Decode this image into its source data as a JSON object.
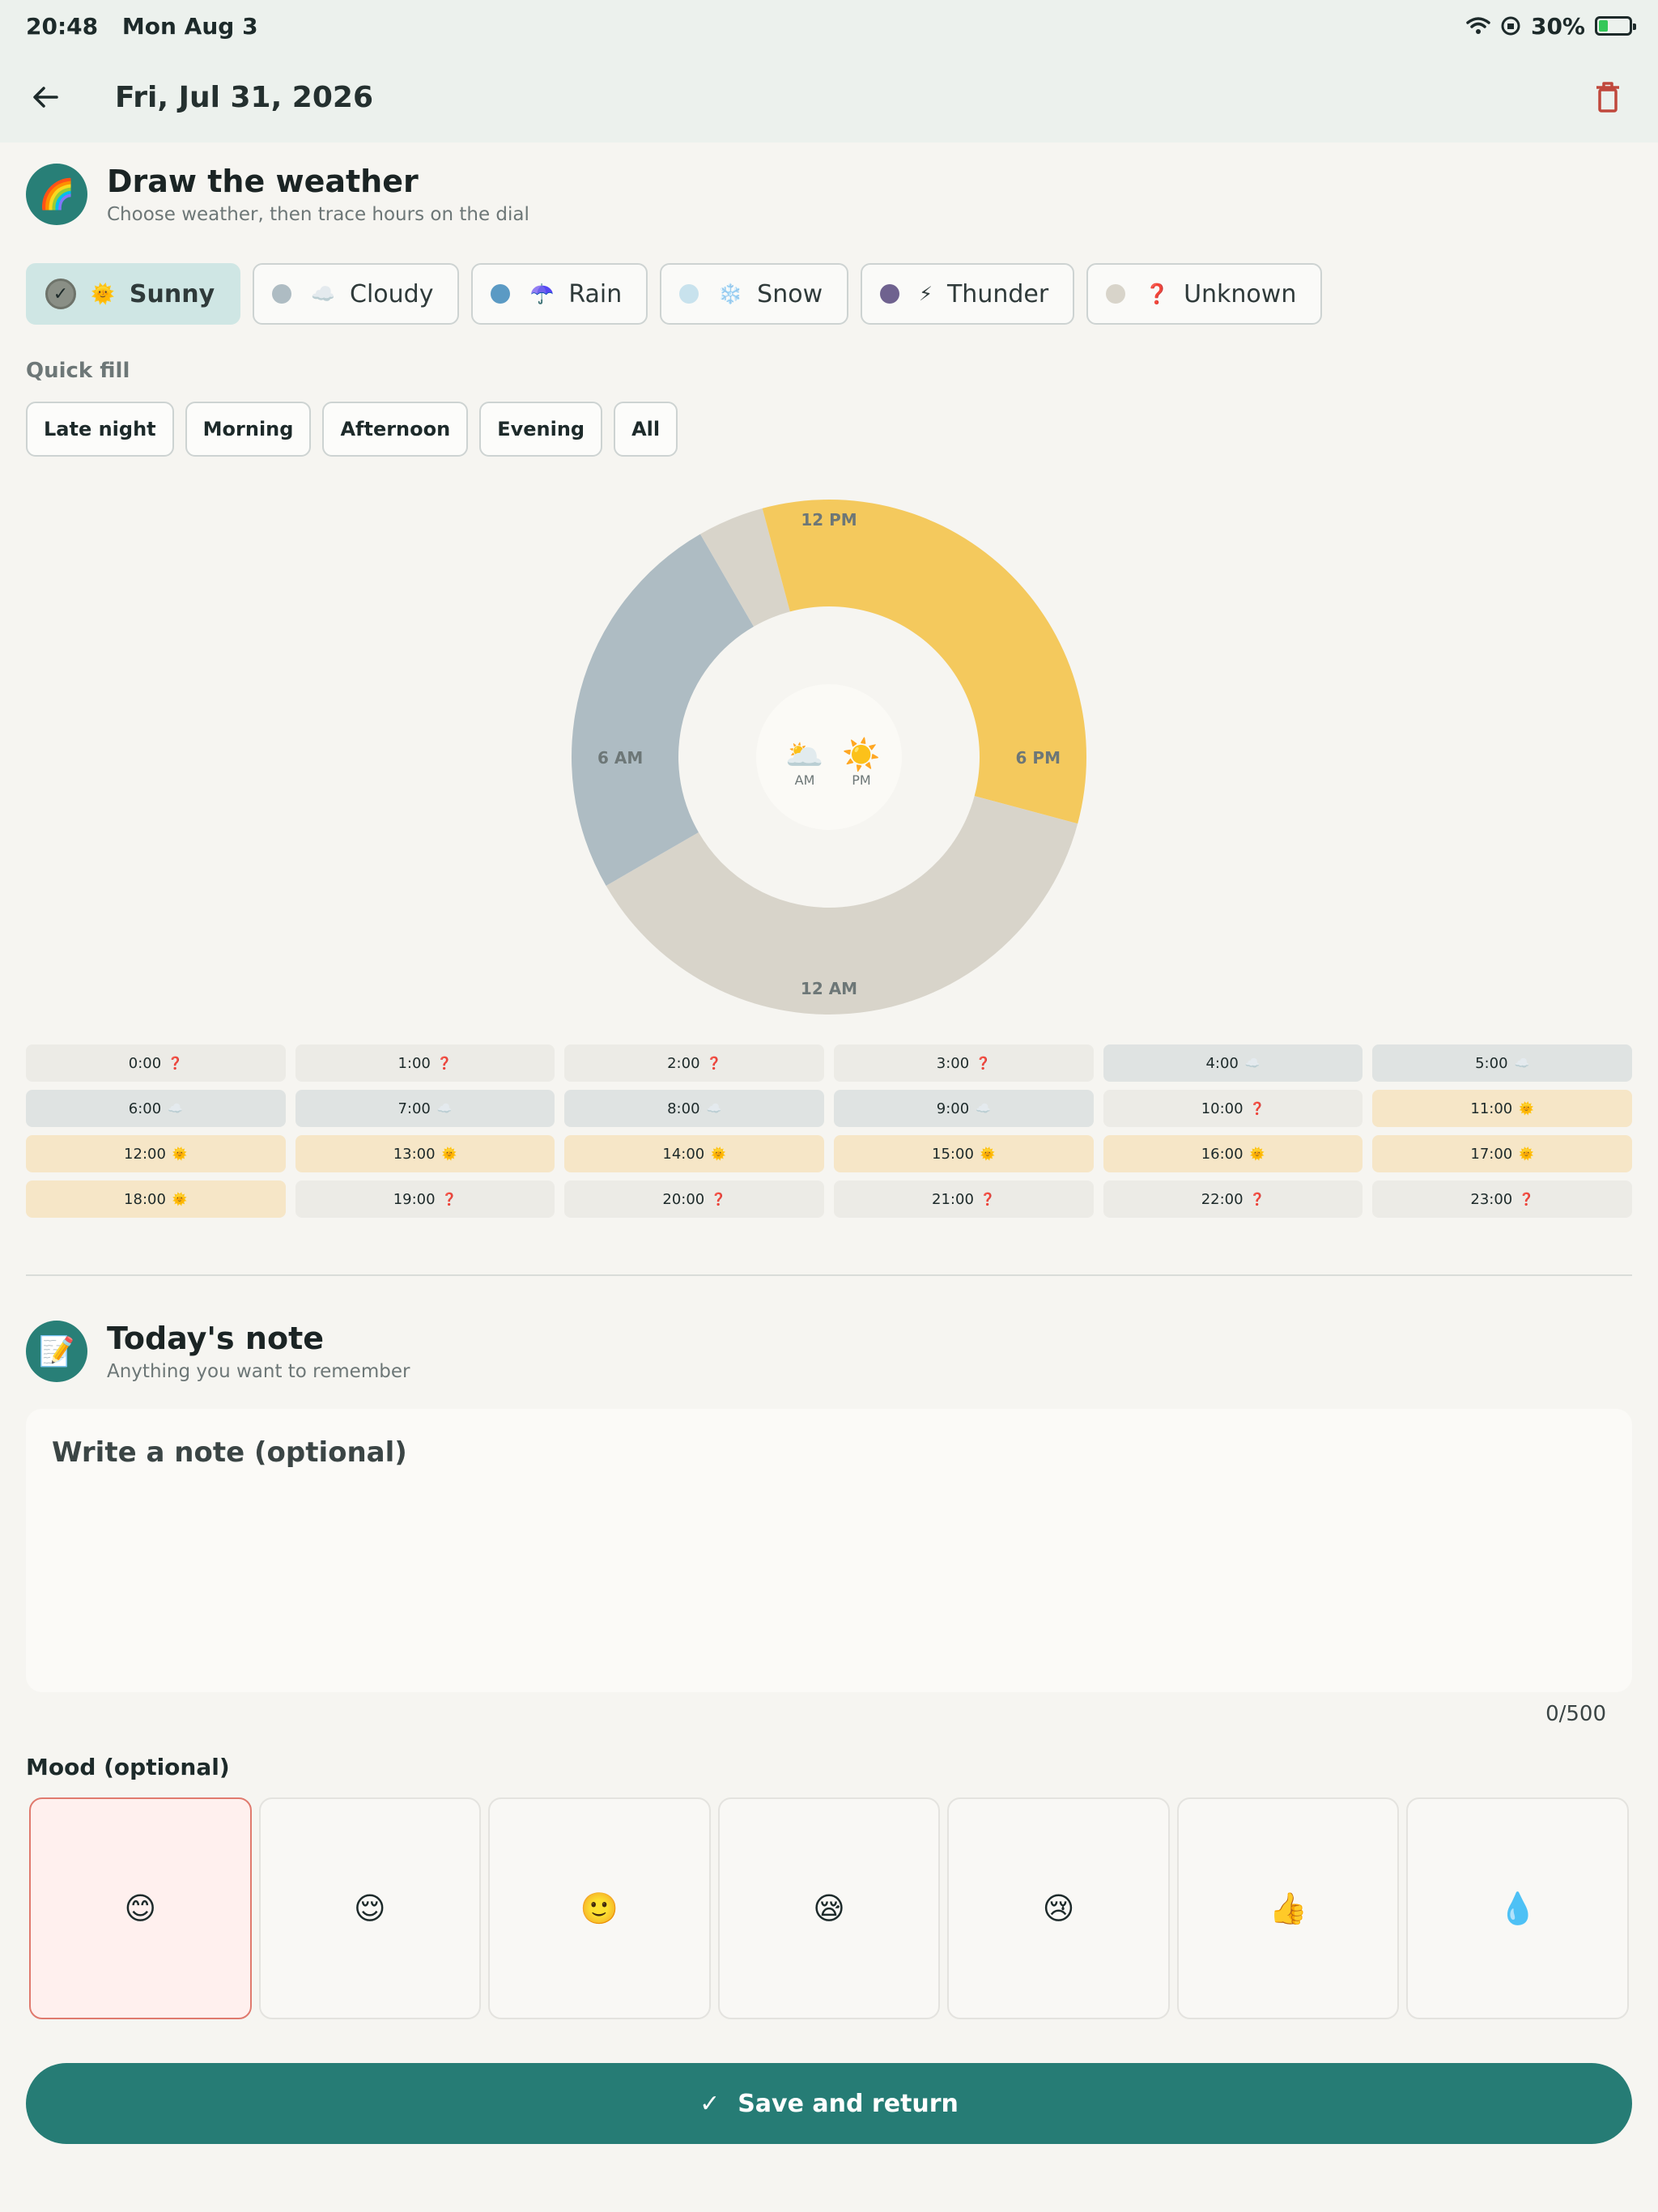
{
  "status": {
    "time": "20:48",
    "date": "Mon Aug 3",
    "battery": "30%",
    "battery_level": 0.3
  },
  "header": {
    "title": "Fri, Jul 31, 2026"
  },
  "weather_section": {
    "icon": "🌈",
    "title": "Draw the weather",
    "subtitle": "Choose weather, then trace hours on the dial",
    "selected": "Sunny",
    "types": [
      {
        "label": "Sunny",
        "emoji": "🌞",
        "color": "#f4c95d"
      },
      {
        "label": "Cloudy",
        "emoji": "☁️",
        "color": "#aebcc3"
      },
      {
        "label": "Rain",
        "emoji": "☂️",
        "color": "#5b9ac4"
      },
      {
        "label": "Snow",
        "emoji": "❄️",
        "color": "#c8e2ed"
      },
      {
        "label": "Thunder",
        "emoji": "⚡",
        "color": "#6f628f"
      },
      {
        "label": "Unknown",
        "emoji": "❓",
        "color": "#d8d4ca"
      }
    ]
  },
  "quick_fill": {
    "label": "Quick fill",
    "buttons": [
      "Late night",
      "Morning",
      "Afternoon",
      "Evening",
      "All"
    ]
  },
  "dial": {
    "labels": {
      "top": "12 PM",
      "right": "6 PM",
      "bottom": "12 AM",
      "left": "6 AM"
    },
    "center": {
      "am_icon": "🌥️",
      "am_label": "AM",
      "pm_icon": "☀️",
      "pm_label": "PM"
    }
  },
  "hours": [
    {
      "label": "0:00",
      "weather": "Unknown"
    },
    {
      "label": "1:00",
      "weather": "Unknown"
    },
    {
      "label": "2:00",
      "weather": "Unknown"
    },
    {
      "label": "3:00",
      "weather": "Unknown"
    },
    {
      "label": "4:00",
      "weather": "Cloudy"
    },
    {
      "label": "5:00",
      "weather": "Cloudy"
    },
    {
      "label": "6:00",
      "weather": "Cloudy"
    },
    {
      "label": "7:00",
      "weather": "Cloudy"
    },
    {
      "label": "8:00",
      "weather": "Cloudy"
    },
    {
      "label": "9:00",
      "weather": "Cloudy"
    },
    {
      "label": "10:00",
      "weather": "Unknown"
    },
    {
      "label": "11:00",
      "weather": "Sunny"
    },
    {
      "label": "12:00",
      "weather": "Sunny"
    },
    {
      "label": "13:00",
      "weather": "Sunny"
    },
    {
      "label": "14:00",
      "weather": "Sunny"
    },
    {
      "label": "15:00",
      "weather": "Sunny"
    },
    {
      "label": "16:00",
      "weather": "Sunny"
    },
    {
      "label": "17:00",
      "weather": "Sunny"
    },
    {
      "label": "18:00",
      "weather": "Sunny"
    },
    {
      "label": "19:00",
      "weather": "Unknown"
    },
    {
      "label": "20:00",
      "weather": "Unknown"
    },
    {
      "label": "21:00",
      "weather": "Unknown"
    },
    {
      "label": "22:00",
      "weather": "Unknown"
    },
    {
      "label": "23:00",
      "weather": "Unknown"
    }
  ],
  "note_section": {
    "icon": "📝",
    "title": "Today's note",
    "subtitle": "Anything you want to remember",
    "placeholder": "Write a note (optional)",
    "value": "",
    "counter": "0/500"
  },
  "mood": {
    "label": "Mood (optional)",
    "selected_index": 0,
    "options": [
      "😊",
      "😌",
      "🙂",
      "😪",
      "😢",
      "👍",
      "💧"
    ]
  },
  "save_button": {
    "label": "Save and return"
  },
  "colors": {
    "accent": "#267c75",
    "delete": "#c0483c"
  }
}
